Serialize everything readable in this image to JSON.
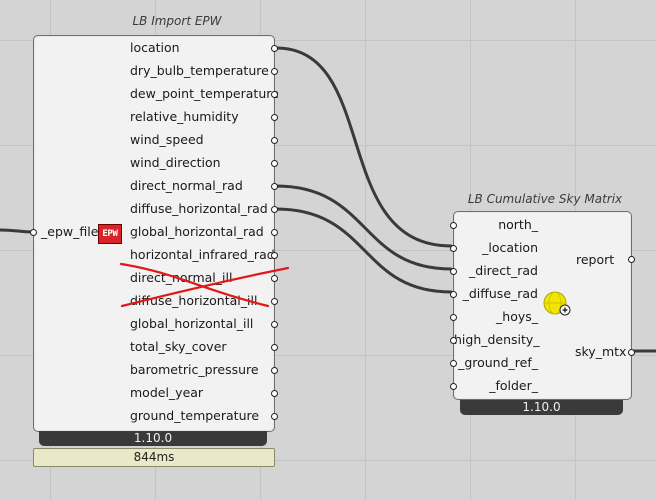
{
  "import_epw": {
    "title": "LB Import EPW",
    "input_label": "_epw_file",
    "icon_label": "EPW",
    "outputs": [
      "location",
      "dry_bulb_temperature",
      "dew_point_temperature",
      "relative_humidity",
      "wind_speed",
      "wind_direction",
      "direct_normal_rad",
      "diffuse_horizontal_rad",
      "global_horizontal_rad",
      "horizontal_infrared_rad",
      "direct_normal_ill",
      "diffuse_horizontal_ill",
      "global_horizontal_ill",
      "total_sky_cover",
      "barometric_pressure",
      "model_year",
      "ground_temperature"
    ],
    "version": "1.10.0",
    "timing": "844ms"
  },
  "sky_matrix": {
    "title": "LB Cumulative Sky Matrix",
    "inputs": [
      "north_",
      "_location",
      "_direct_rad",
      "_diffuse_rad",
      "_hoys_",
      "high_density_",
      "_ground_ref_",
      "_folder_"
    ],
    "outputs": [
      "report",
      "sky_mtx"
    ],
    "version": "1.10.0"
  },
  "colors": {
    "strike": "#e01818",
    "version_bar": "#3a3a3a",
    "icon_red": "#d9252a",
    "sky_yellow": "#f2e600"
  }
}
